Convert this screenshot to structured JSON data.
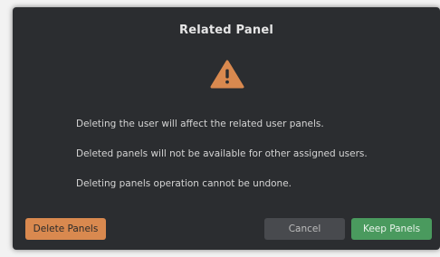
{
  "dialog": {
    "title": "Related Panel",
    "icon": "warning-triangle-icon",
    "messages": [
      "Deleting the user will affect the related user panels.",
      "Deleted panels will not be available for other assigned users.",
      "Deleting panels operation cannot be undone."
    ],
    "buttons": {
      "delete_label": "Delete Panels",
      "cancel_label": "Cancel",
      "keep_label": "Keep Panels"
    }
  },
  "colors": {
    "dialog_bg": "#2b2d30",
    "warning": "#d9894f",
    "delete_button": "#d9894f",
    "cancel_button": "#484a4e",
    "keep_button": "#4a9a5e"
  }
}
